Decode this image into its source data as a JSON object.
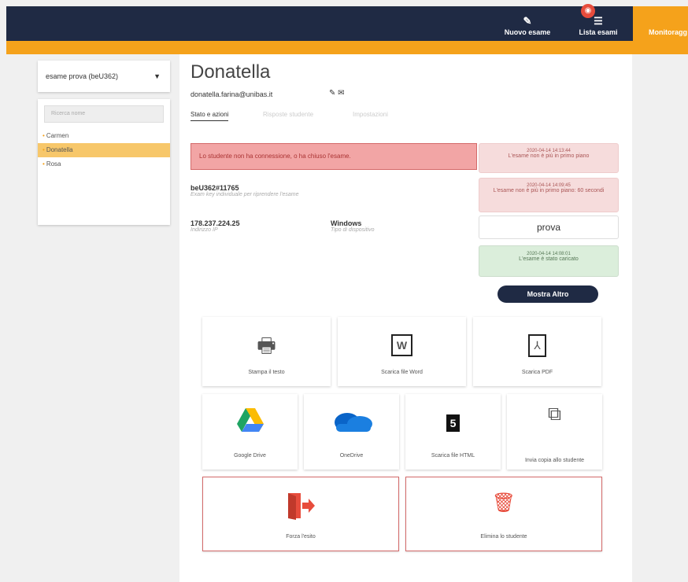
{
  "header": {
    "nav": [
      {
        "label": "Nuovo esame",
        "icon": "pencil-icon"
      },
      {
        "label": "Lista esami",
        "icon": "list-icon"
      },
      {
        "label": "Monitoragg",
        "icon": "monitor-icon"
      }
    ]
  },
  "left": {
    "exam_select": "esame prova (beU362)",
    "search_placeholder": "Ricerca nome",
    "students": [
      "Carmen",
      "Donatella",
      "Rosa"
    ],
    "active_student": "Donatella"
  },
  "student": {
    "name": "Donatella",
    "email": "donatella.farina@unibas.it",
    "tabs": [
      "Stato e azioni",
      "Risposte studente",
      "Impostazioni"
    ],
    "alert": "Lo studente non ha connessione, o ha chiuso l'esame.",
    "exam_key": "beU362#11765",
    "exam_key_sub": "Exam key individuale per riprendere l'esame",
    "ip": "178.237.224.25",
    "ip_sub": "Indirizzo IP",
    "device": "Windows",
    "device_sub": "Tipo di dispositivo"
  },
  "log": [
    {
      "ts": "2020-04-14 14:13:44",
      "text": "L'esame non è più in primo piano"
    },
    {
      "ts": "2020-04-14 14:09:45",
      "text": "L'esame non è più in primo piano: 60 secondi"
    },
    {
      "ts": "",
      "text": "prova"
    },
    {
      "ts": "2020-04-14 14:08:01",
      "text": "L'esame è stato caricato"
    }
  ],
  "more_button": "Mostra Altro",
  "actions": {
    "print": "Stampa il testo",
    "word": "Scarica file Word",
    "pdf": "Scarica PDF",
    "gdrive": "Google Drive",
    "onedrive": "OneDrive",
    "html": "Scarica file HTML",
    "send_copy": "Invia copia allo studente",
    "force_exit": "Forza l'esito",
    "delete": "Elimina lo studente"
  },
  "colors": {
    "navy": "#1f2a44",
    "orange": "#f5a21b",
    "danger": "#e74c3c"
  }
}
